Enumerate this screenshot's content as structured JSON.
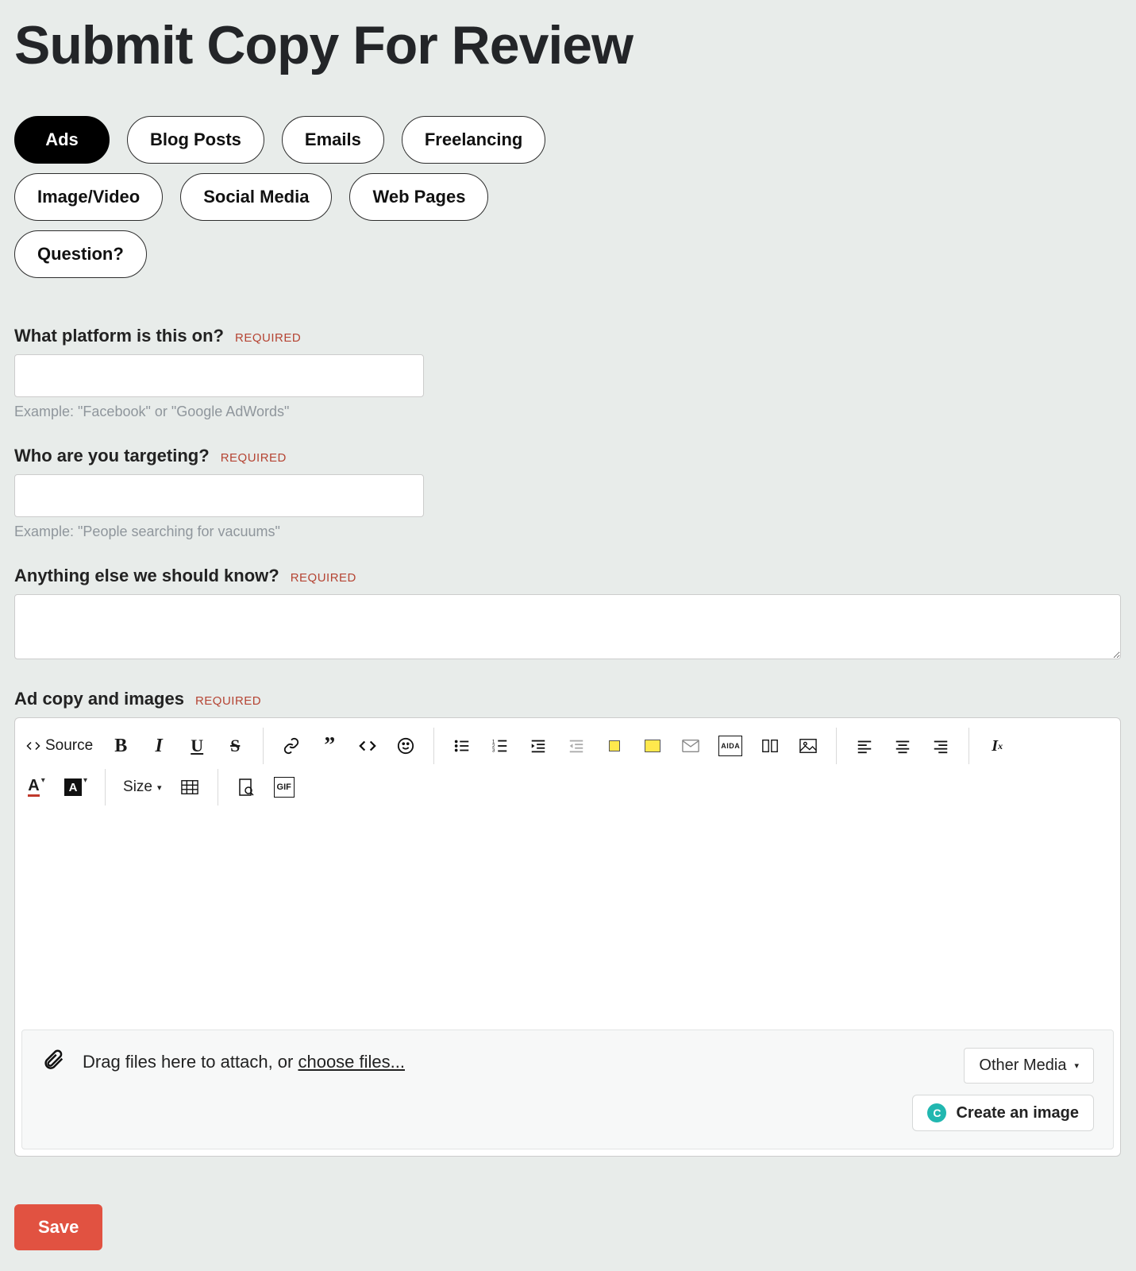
{
  "page": {
    "title": "Submit Copy For Review"
  },
  "tabs": [
    {
      "label": "Ads",
      "active": true
    },
    {
      "label": "Blog Posts",
      "active": false
    },
    {
      "label": "Emails",
      "active": false
    },
    {
      "label": "Freelancing",
      "active": false
    },
    {
      "label": "Image/Video",
      "active": false
    },
    {
      "label": "Social Media",
      "active": false
    },
    {
      "label": "Web Pages",
      "active": false
    },
    {
      "label": "Question?",
      "active": false
    }
  ],
  "fields": {
    "platform": {
      "label": "What platform is this on?",
      "required": "REQUIRED",
      "value": "",
      "hint": "Example: \"Facebook\" or \"Google AdWords\""
    },
    "targeting": {
      "label": "Who are you targeting?",
      "required": "REQUIRED",
      "value": "",
      "hint": "Example: \"People searching for vacuums\""
    },
    "notes": {
      "label": "Anything else we should know?",
      "required": "REQUIRED",
      "value": ""
    },
    "adcopy": {
      "label": "Ad copy and images",
      "required": "REQUIRED"
    }
  },
  "editor_toolbar": {
    "source_label": "Source",
    "size_label": "Size"
  },
  "dropzone": {
    "prefix": "Drag files here to attach, or ",
    "choose": "choose files...",
    "other_media": "Other Media",
    "create_image": "Create an image",
    "create_badge": "C"
  },
  "actions": {
    "save": "Save"
  }
}
